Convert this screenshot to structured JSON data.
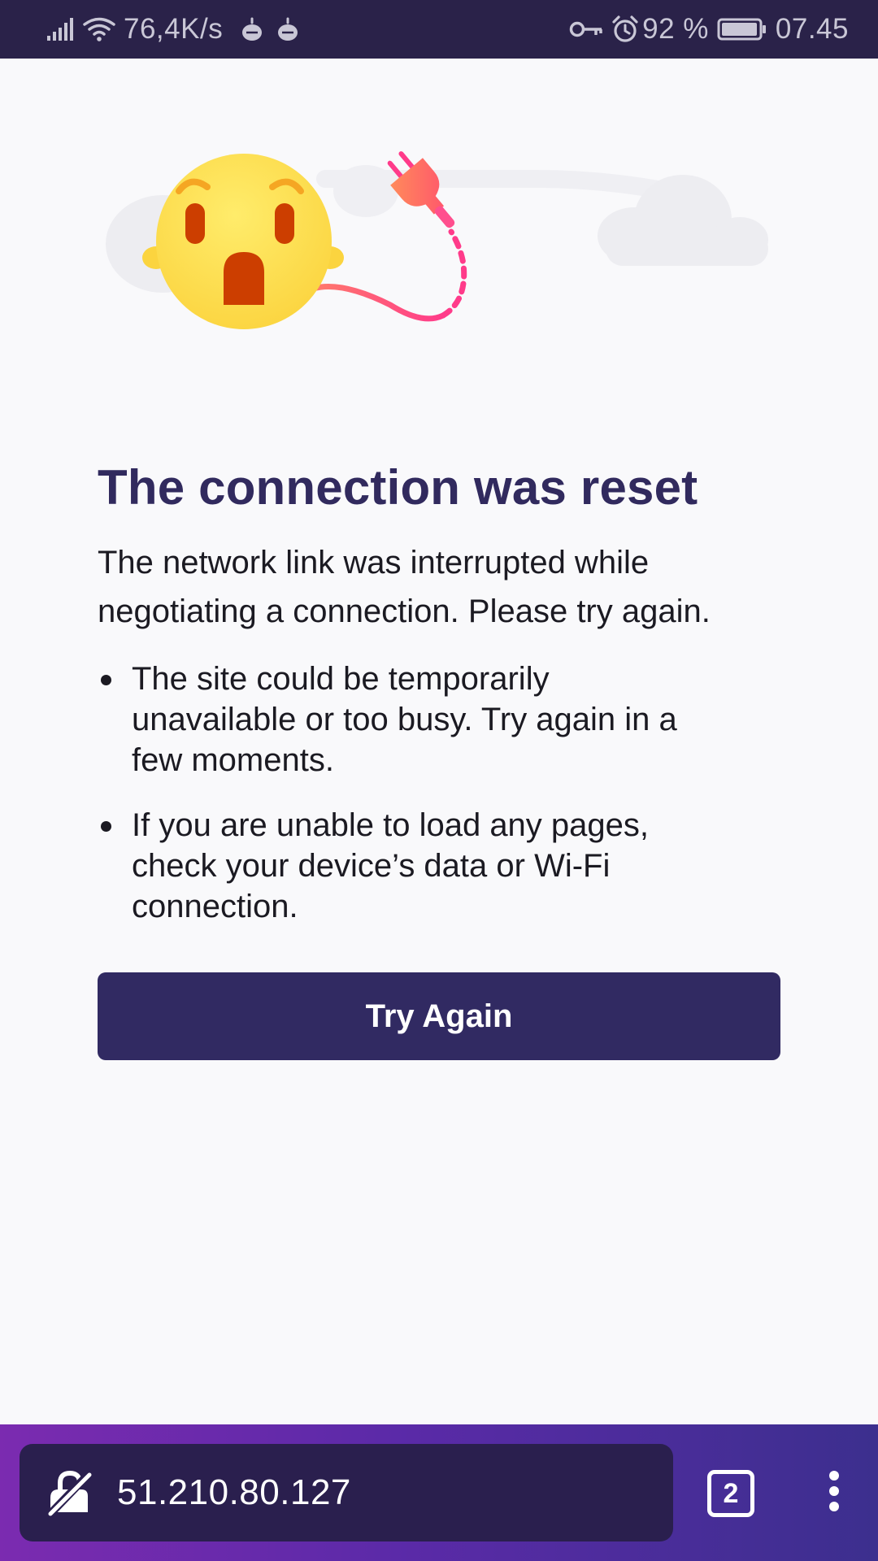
{
  "status_bar": {
    "network_speed": "76,4K/s",
    "battery": "92 %",
    "time": "07.45",
    "icons": [
      "signal-icon",
      "wifi-icon",
      "app-notification-icon",
      "key-icon",
      "alarm-icon",
      "battery-icon"
    ]
  },
  "error_page": {
    "illustration": "disconnected-plug-emoji",
    "title": "The connection was reset",
    "description": "The network link was interrupted while negotiating a connection. Please try again.",
    "tips": [
      "The site could be temporarily unavailable or too busy. Try again in a few moments.",
      "If you are unable to load any pages, check your device’s data or Wi-Fi connection."
    ],
    "button_label": "Try Again"
  },
  "toolbar": {
    "url": "51.210.80.127",
    "tab_count": "2",
    "icons": [
      "insecure-connection-icon",
      "tabs-counter",
      "more-menu-icon"
    ]
  },
  "colors": {
    "status_bar_bg": "#2a2249",
    "title": "#312a5e",
    "button_bg": "#312a62",
    "page_bg": "#f9f9fb",
    "toolbar_gradient_start": "#7b2bb0",
    "toolbar_gradient_end": "#3c2f8e"
  }
}
